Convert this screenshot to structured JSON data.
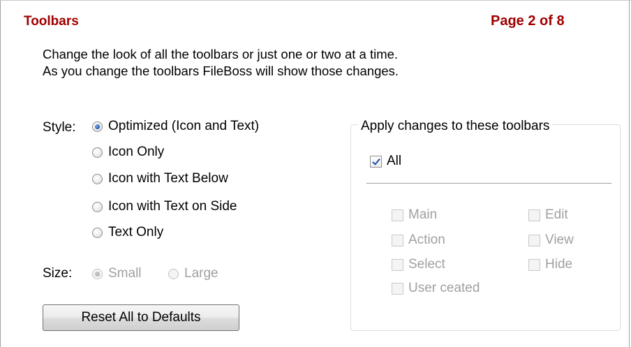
{
  "header": {
    "title": "Toolbars",
    "page_indicator": "Page 2 of 8"
  },
  "description": {
    "line1": "Change the look of all the toolbars or just one or two at a time.",
    "line2": "As you change the toolbars FileBoss will show those changes."
  },
  "style": {
    "label": "Style:",
    "options": [
      {
        "label": "Optimized (Icon and Text)",
        "selected": true
      },
      {
        "label": "Icon Only",
        "selected": false
      },
      {
        "label": "Icon with Text Below",
        "selected": false
      },
      {
        "label": "Icon with Text on Side",
        "selected": false
      },
      {
        "label": "Text Only",
        "selected": false
      }
    ]
  },
  "size": {
    "label": "Size:",
    "enabled": false,
    "options": [
      {
        "label": "Small",
        "selected": true
      },
      {
        "label": "Large",
        "selected": false
      }
    ]
  },
  "reset_button": {
    "label": "Reset All to Defaults"
  },
  "apply_group": {
    "legend": "Apply changes to these toolbars",
    "all": {
      "label": "All",
      "checked": true
    },
    "toolbars": [
      {
        "label": "Main",
        "checked": false,
        "enabled": false
      },
      {
        "label": "Edit",
        "checked": false,
        "enabled": false
      },
      {
        "label": "Action",
        "checked": false,
        "enabled": false
      },
      {
        "label": "View",
        "checked": false,
        "enabled": false
      },
      {
        "label": "Select",
        "checked": false,
        "enabled": false
      },
      {
        "label": "Hide",
        "checked": false,
        "enabled": false
      },
      {
        "label": "User ceated",
        "checked": false,
        "enabled": false
      }
    ]
  },
  "colors": {
    "title": "#a00000",
    "disabled_text": "#a0a0a0",
    "radio_dot": "#2563b8",
    "checkmark": "#1f4fa8"
  }
}
